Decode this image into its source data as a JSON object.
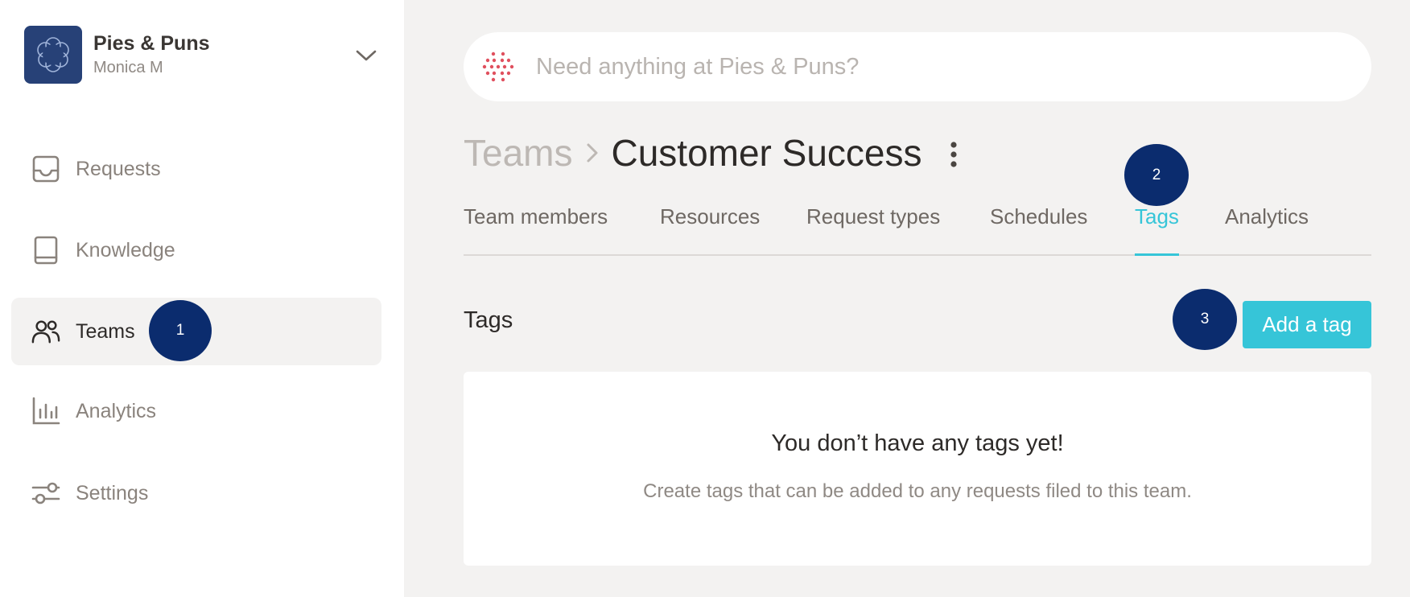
{
  "org": {
    "name": "Pies & Puns",
    "user": "Monica M"
  },
  "sidebar": {
    "items": [
      {
        "label": "Requests",
        "icon": "inbox-icon"
      },
      {
        "label": "Knowledge",
        "icon": "book-icon"
      },
      {
        "label": "Teams",
        "icon": "users-icon",
        "active": true
      },
      {
        "label": "Analytics",
        "icon": "bar-chart-icon"
      },
      {
        "label": "Settings",
        "icon": "sliders-icon"
      }
    ]
  },
  "search": {
    "placeholder": "Need anything at Pies & Puns?",
    "value": ""
  },
  "breadcrumb": {
    "parent": "Teams",
    "current": "Customer Success"
  },
  "tabs": [
    {
      "label": "Team members"
    },
    {
      "label": "Resources"
    },
    {
      "label": "Request types"
    },
    {
      "label": "Schedules"
    },
    {
      "label": "Tags",
      "active": true
    },
    {
      "label": "Analytics"
    }
  ],
  "section": {
    "title": "Tags",
    "add_button": "Add a tag"
  },
  "empty_state": {
    "title": "You don’t have any tags yet!",
    "description": "Create tags that can be added to any requests filed to this team."
  },
  "markers": [
    "1",
    "2",
    "3"
  ],
  "colors": {
    "accent": "#36c5d8",
    "brand": "#274177",
    "marker": "#0b2c6e",
    "search_icon": "#e0505e"
  }
}
